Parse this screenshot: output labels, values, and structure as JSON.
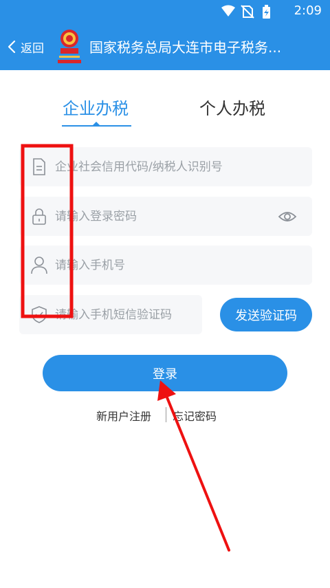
{
  "status_bar": {
    "time": "2:09",
    "icons": [
      "wifi-icon",
      "no-sim-icon",
      "battery-charging-icon"
    ]
  },
  "app_bar": {
    "back_label": "返回",
    "title": "国家税务总局大连市电子税务...",
    "logo": "tax-bureau-emblem"
  },
  "tabs": [
    {
      "label": "企业办税",
      "active": true
    },
    {
      "label": "个人办税",
      "active": false
    }
  ],
  "form": {
    "credit_code": {
      "placeholder": "企业社会信用代码/纳税人识别号",
      "value": ""
    },
    "password": {
      "placeholder": "请输入登录密码",
      "value": ""
    },
    "phone": {
      "placeholder": "请输入手机号",
      "value": ""
    },
    "sms_code": {
      "placeholder": "请输入手机短信验证码",
      "value": ""
    },
    "send_code_label": "发送验证码",
    "login_label": "登录"
  },
  "links": {
    "register": "新用户注册",
    "forgot": "忘记密码"
  },
  "colors": {
    "primary": "#2a90e6",
    "field_bg": "#f6f7f9",
    "annotation": "#ee1111"
  }
}
